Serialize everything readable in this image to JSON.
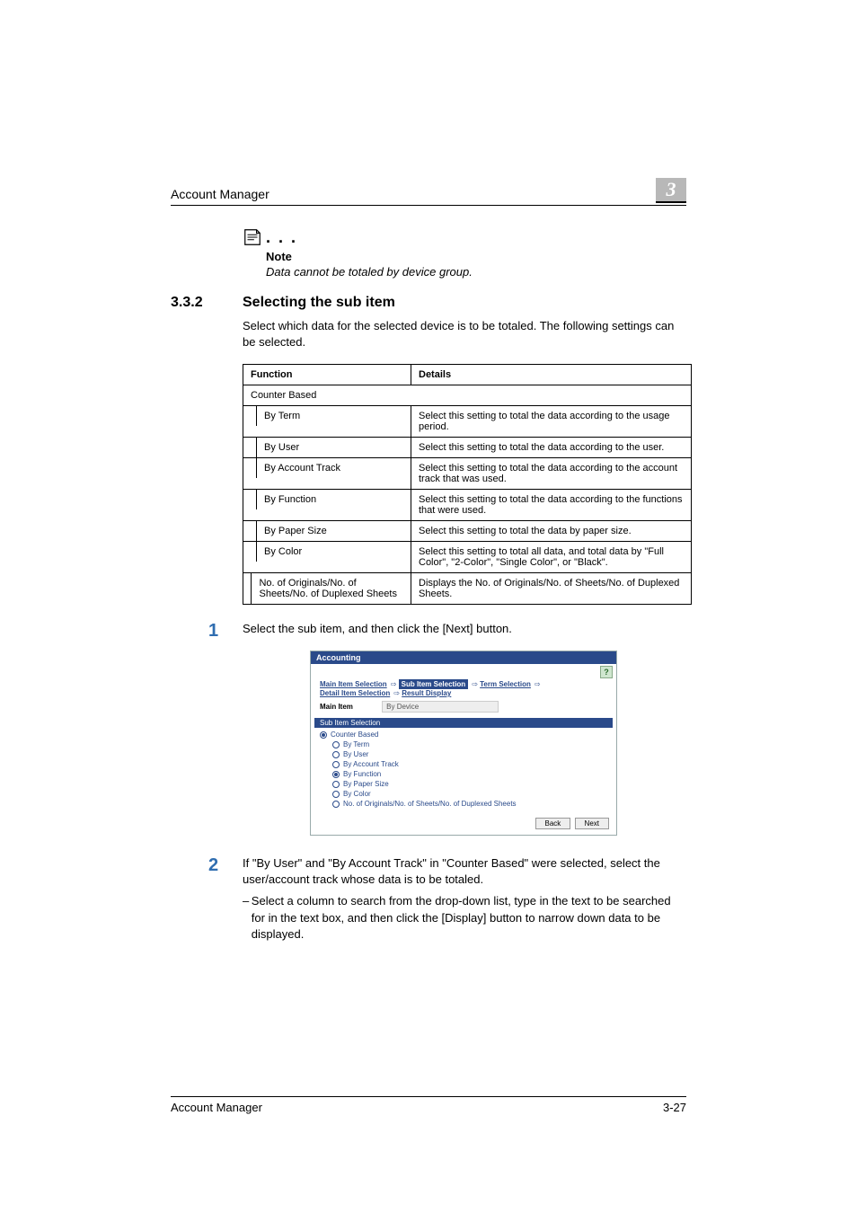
{
  "header": {
    "running_title": "Account Manager",
    "chapter_number": "3"
  },
  "note": {
    "label": "Note",
    "text": "Data cannot be totaled by device group."
  },
  "section": {
    "number": "3.3.2",
    "title": "Selecting the sub item",
    "intro": "Select which data for the selected device is to be totaled. The following settings can be selected."
  },
  "table": {
    "head_function": "Function",
    "head_details": "Details",
    "group": "Counter Based",
    "rows": [
      {
        "f": "By Term",
        "d": "Select this setting to total the data according to the usage period."
      },
      {
        "f": "By User",
        "d": "Select this setting to total the data according to the user."
      },
      {
        "f": "By Account Track",
        "d": "Select this setting to total the data according to the account track that was used."
      },
      {
        "f": "By Function",
        "d": "Select this setting to total the data according to the functions that were used."
      },
      {
        "f": "By Paper Size",
        "d": "Select this setting to total the data by paper size."
      },
      {
        "f": "By Color",
        "d": "Select this setting to total all data, and total data by \"Full Color\", \"2-Color\", \"Single Color\", or \"Black\"."
      },
      {
        "f": "No. of Originals/No. of Sheets/No. of Duplexed Sheets",
        "d": "Displays the No. of Originals/No. of Sheets/No. of Duplexed Sheets."
      }
    ]
  },
  "steps": {
    "s1": {
      "num": "1",
      "text": "Select the sub item, and then click the [Next] button."
    },
    "s2": {
      "num": "2",
      "text": "If \"By User\" and \"By Account Track\" in \"Counter Based\" were selected, select the user/account track whose data is to be totaled.",
      "bullet": "Select a column to search from the drop-down list, type in the text to be searched for in the text box, and then click the [Display] button to narrow down data to be displayed."
    }
  },
  "screenshot": {
    "title": "Accounting",
    "help": "?",
    "breadcrumbs": {
      "a": "Main Item Selection",
      "b": "Sub Item Selection",
      "c": "Term Selection",
      "d": "Detail Item Selection",
      "e": "Result Display"
    },
    "main_item_label": "Main Item",
    "main_item_value": "By Device",
    "section_label": "Sub Item Selection",
    "options": {
      "counter": "Counter Based",
      "term": "By Term",
      "user": "By User",
      "acct": "By Account Track",
      "func": "By Function",
      "paper": "By Paper Size",
      "color": "By Color",
      "sheets": "No. of Originals/No. of Sheets/No. of Duplexed Sheets"
    },
    "back": "Back",
    "next": "Next"
  },
  "footer": {
    "left": "Account Manager",
    "right": "3-27"
  }
}
